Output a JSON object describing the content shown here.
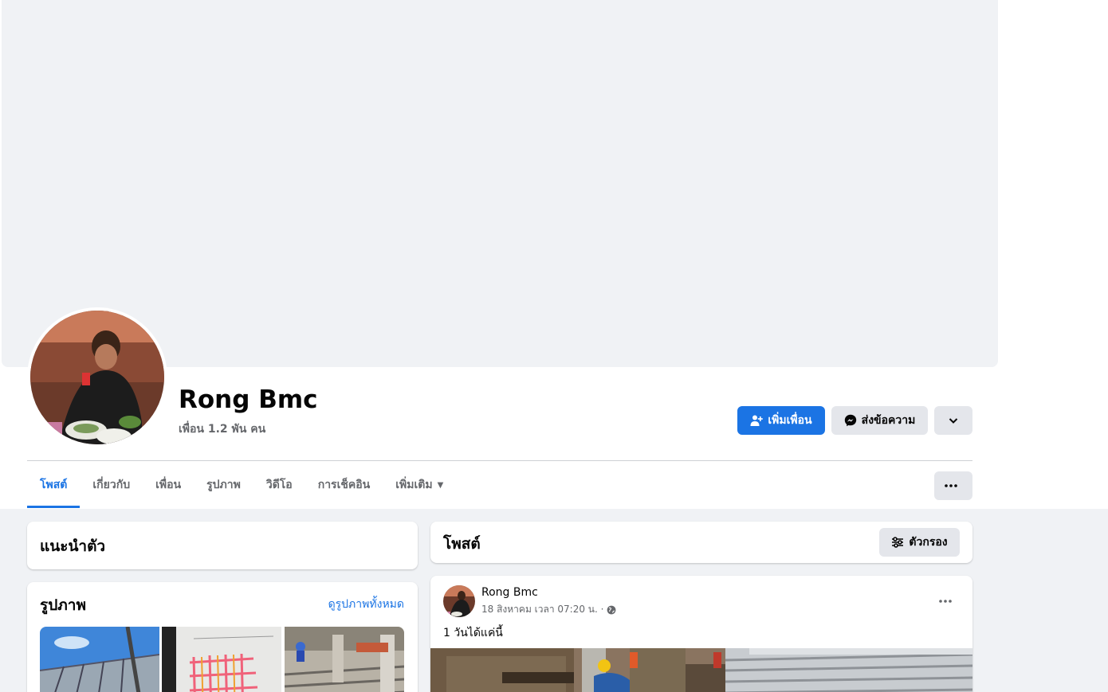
{
  "profile": {
    "name": "Rong Bmc",
    "friends_count": "เพื่อน 1.2 พัน คน"
  },
  "actions": {
    "add_friend": "เพิ่มเพื่อน",
    "message": "ส่งข้อความ"
  },
  "tabs": [
    {
      "label": "โพสต์",
      "active": true
    },
    {
      "label": "เกี่ยวกับ",
      "active": false
    },
    {
      "label": "เพื่อน",
      "active": false
    },
    {
      "label": "รูปภาพ",
      "active": false
    },
    {
      "label": "วิดีโอ",
      "active": false
    },
    {
      "label": "การเช็คอิน",
      "active": false
    },
    {
      "label": "เพิ่มเติม",
      "active": false
    }
  ],
  "intro": {
    "title": "แนะนำตัว"
  },
  "photos": {
    "title": "รูปภาพ",
    "see_all": "ดูรูปภาพทั้งหมด"
  },
  "posts": {
    "title": "โพสต์",
    "filter_label": "ตัวกรอง"
  },
  "post": {
    "author": "Rong Bmc",
    "timestamp": "18 สิงหาคม เวลา 07:20 น. ·",
    "text": "1 วันได้แค่นี้"
  },
  "colors": {
    "accent": "#1b74e4",
    "secondary_button": "#e4e6eb",
    "page_background": "#f0f2f5",
    "muted_text": "#65676b"
  },
  "icons": {
    "add_friend": "person-plus-icon",
    "message": "messenger-icon",
    "dropdown": "chevron-down-icon",
    "more": "ellipsis-icon",
    "filter": "sliders-icon",
    "privacy": "globe-icon"
  }
}
